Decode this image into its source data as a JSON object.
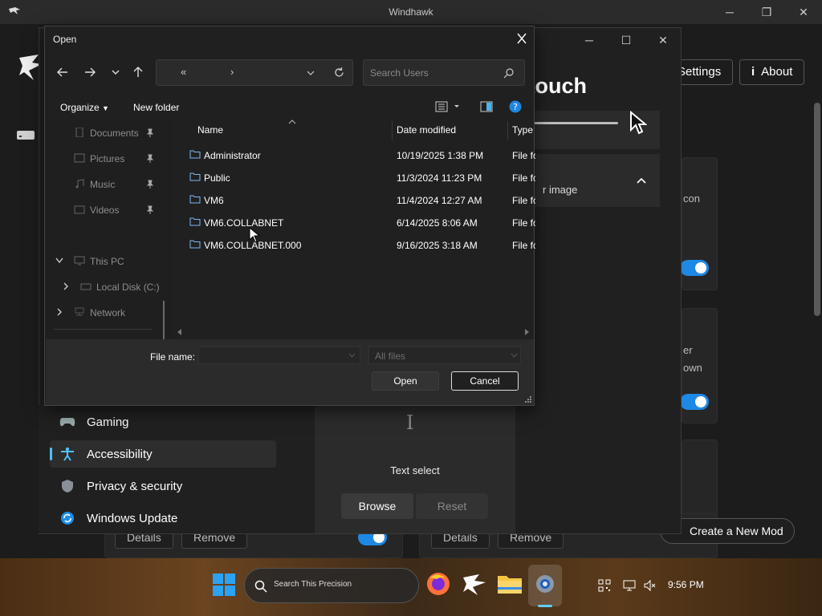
{
  "windhawk": {
    "title": "Windhawk",
    "settings_btn": "Settings",
    "about_btn": "About",
    "info_icon": "i",
    "clipped_texts": [
      "con",
      "er",
      "own"
    ],
    "details_label": "Details",
    "remove_label": "Remove",
    "create_mod_label": "Create a New Mod",
    "create_mod_plus": "+"
  },
  "settings_window": {
    "heading_partial": "nd touch",
    "subtitle_partial": "r image",
    "nav": [
      {
        "label": "Gaming",
        "icon": "gamepad-icon"
      },
      {
        "label": "Accessibility",
        "icon": "accessibility-icon",
        "active": true
      },
      {
        "label": "Privacy & security",
        "icon": "shield-icon"
      },
      {
        "label": "Windows Update",
        "icon": "windows-update-icon"
      }
    ],
    "preview": {
      "cursor_glyph": "I",
      "caption": "Text select",
      "browse": "Browse",
      "reset": "Reset"
    }
  },
  "open_dialog": {
    "title": "Open",
    "address": {
      "prefix": "«",
      "chevron": "›"
    },
    "search_placeholder": "Search Users",
    "toolbar": {
      "organize": "Organize",
      "new_folder": "New folder"
    },
    "sidebar": {
      "quick_access": [
        {
          "label": "Documents",
          "pinned": true
        },
        {
          "label": "Pictures",
          "pinned": true
        },
        {
          "label": "Music",
          "pinned": true
        },
        {
          "label": "Videos",
          "pinned": true
        }
      ],
      "this_pc": "This PC",
      "local_disk": "Local Disk (C:)",
      "network": "Network"
    },
    "columns": {
      "name": "Name",
      "date": "Date modified",
      "type": "Type"
    },
    "files": [
      {
        "name": "Administrator",
        "date": "10/19/2025 1:38 PM",
        "type": "File folder"
      },
      {
        "name": "Public",
        "date": "11/3/2024 11:23 PM",
        "type": "File folder"
      },
      {
        "name": "VM6",
        "date": "11/4/2024 12:27 AM",
        "type": "File folder"
      },
      {
        "name": "VM6.COLLABNET",
        "date": "6/14/2025 8:06 AM",
        "type": "File folder"
      },
      {
        "name": "VM6.COLLABNET.000",
        "date": "9/16/2025 3:18 AM",
        "type": "File folder"
      }
    ],
    "file_name_label": "File name:",
    "file_name_value": "",
    "file_type_selected": "All files",
    "open_btn": "Open",
    "cancel_btn": "Cancel"
  },
  "taskbar": {
    "search_text": "Search This Precision",
    "clock": "9:56 PM",
    "apps": [
      "firefox-icon",
      "windhawk-icon",
      "file-explorer-icon",
      "settings-icon"
    ]
  },
  "colors": {
    "accent": "#4cc2ff",
    "toggle_on": "#1e88e5",
    "folder_blue": "#7ab8f5"
  }
}
